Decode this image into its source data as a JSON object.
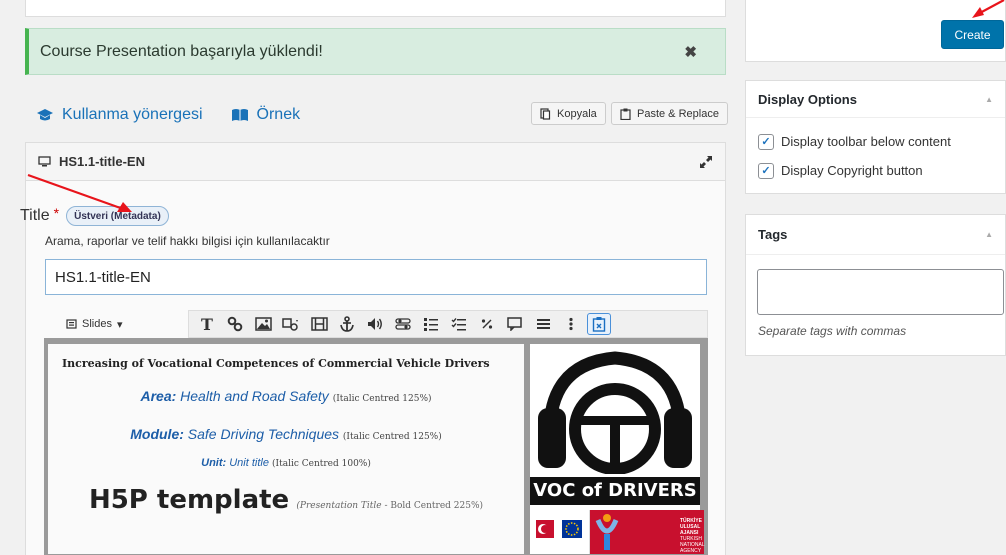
{
  "notice": {
    "message": "Course Presentation başarıyla yüklendi!",
    "close_glyph": "✖"
  },
  "links": {
    "guide": "Kullanma yönergesi",
    "example": "Örnek"
  },
  "buttons": {
    "copy": "Kopyala",
    "paste_replace": "Paste & Replace"
  },
  "editor": {
    "heading": "HS1.1-title-EN",
    "title_label": "Title",
    "required_mark": "*",
    "metadata_button": "Üstveri (Metadata)",
    "description": "Arama, raporlar ve telif hakkı bilgisi için kullanılacaktır",
    "title_value": "HS1.1-title-EN"
  },
  "toolbar": {
    "slides_label": "Slides",
    "text_tool": "T"
  },
  "slide": {
    "title": "Increasing of Vocational Competences of Commercial Vehicle Drivers",
    "area_label": "Area:",
    "area_value": "Health and Road Safety",
    "area_note": "(Italic Centred 125%)",
    "module_label": "Module:",
    "module_value": "Safe Driving Techniques",
    "module_note": "(Italic Centred 125%)",
    "unit_label": "Unit:",
    "unit_value": "Unit title",
    "unit_note": "(Italic Centred 100%)",
    "template_title": "H5P template",
    "template_note_italic": "(Presentation Title",
    "template_note_rest": " - Bold Centred 225%)",
    "logo_text": "VOC of DRIVERS",
    "agency_line1": "TÜRKİYE ULUSAL AJANSI",
    "agency_line2": "TURKISH NATIONAL AGENCY"
  },
  "sidebar": {
    "create_button": "Create",
    "display_options": {
      "title": "Display Options",
      "options": [
        {
          "label": "Display toolbar below content",
          "checked": true
        },
        {
          "label": "Display Copyright button",
          "checked": true
        }
      ]
    },
    "tags": {
      "title": "Tags",
      "hint": "Separate tags with commas"
    }
  },
  "colors": {
    "accent": "#0073aa",
    "link": "#1a72b8",
    "notice_bg": "#d8ede0",
    "arrow": "#e8141b"
  }
}
